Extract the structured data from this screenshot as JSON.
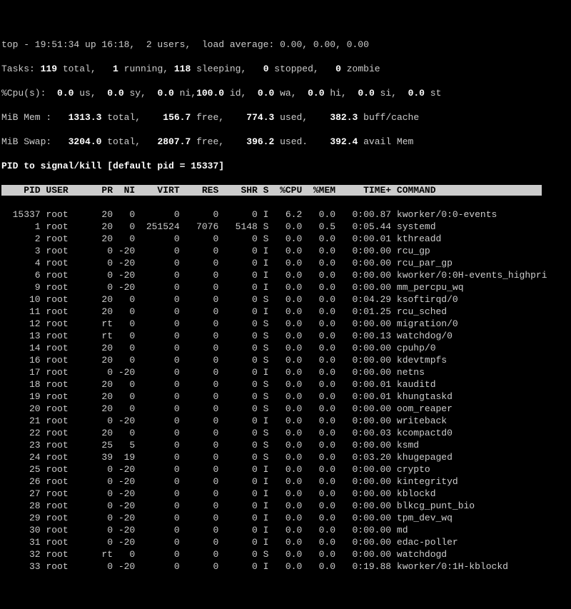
{
  "summary": {
    "line1_a": "top - 19:51:34 up 16:18,  2 users,  load average: 0.00, 0.00, 0.00",
    "tasks": {
      "label": "Tasks:",
      "total": "119",
      "running": "1",
      "sleeping": "118",
      "stopped": "0",
      "zombie": "0"
    },
    "cpu": {
      "label": "%Cpu(s):",
      "us": "0.0",
      "sy": "0.0",
      "ni": "0.0",
      "id": "100.0",
      "wa": "0.0",
      "hi": "0.0",
      "si": "0.0",
      "st": "0.0"
    },
    "mem": {
      "label": "MiB Mem :",
      "total": "1313.3",
      "free": "156.7",
      "used": "774.3",
      "buff": "382.3"
    },
    "swap": {
      "label": "MiB Swap:",
      "total": "3204.0",
      "free": "2807.7",
      "used": "396.2",
      "avail": "392.4"
    }
  },
  "prompt": "PID to signal/kill [default pid = 15337] ",
  "columns": "    PID USER      PR  NI    VIRT    RES    SHR S  %CPU  %MEM     TIME+ COMMAND                   ",
  "rows": [
    {
      "l": "  15337 root      20   0       0      0      0 I   6.2   0.0   0:00.87 kworker/0:0-events        "
    },
    {
      "l": "      1 root      20   0  251524   7076   5148 S   0.0   0.5   0:05.44 systemd                   "
    },
    {
      "l": "      2 root      20   0       0      0      0 S   0.0   0.0   0:00.01 kthreadd                  "
    },
    {
      "l": "      3 root       0 -20       0      0      0 I   0.0   0.0   0:00.00 rcu_gp                    "
    },
    {
      "l": "      4 root       0 -20       0      0      0 I   0.0   0.0   0:00.00 rcu_par_gp                "
    },
    {
      "l": "      6 root       0 -20       0      0      0 I   0.0   0.0   0:00.00 kworker/0:0H-events_highpri"
    },
    {
      "l": "      9 root       0 -20       0      0      0 I   0.0   0.0   0:00.00 mm_percpu_wq              "
    },
    {
      "l": "     10 root      20   0       0      0      0 S   0.0   0.0   0:04.29 ksoftirqd/0               "
    },
    {
      "l": "     11 root      20   0       0      0      0 I   0.0   0.0   0:01.25 rcu_sched                 "
    },
    {
      "l": "     12 root      rt   0       0      0      0 S   0.0   0.0   0:00.00 migration/0               "
    },
    {
      "l": "     13 root      rt   0       0      0      0 S   0.0   0.0   0:00.13 watchdog/0                "
    },
    {
      "l": "     14 root      20   0       0      0      0 S   0.0   0.0   0:00.00 cpuhp/0                   "
    },
    {
      "l": "     16 root      20   0       0      0      0 S   0.0   0.0   0:00.00 kdevtmpfs                 "
    },
    {
      "l": "     17 root       0 -20       0      0      0 I   0.0   0.0   0:00.00 netns                     "
    },
    {
      "l": "     18 root      20   0       0      0      0 S   0.0   0.0   0:00.01 kauditd                   "
    },
    {
      "l": "     19 root      20   0       0      0      0 S   0.0   0.0   0:00.01 khungtaskd                "
    },
    {
      "l": "     20 root      20   0       0      0      0 S   0.0   0.0   0:00.00 oom_reaper                "
    },
    {
      "l": "     21 root       0 -20       0      0      0 I   0.0   0.0   0:00.00 writeback                 "
    },
    {
      "l": "     22 root      20   0       0      0      0 S   0.0   0.0   0:00.03 kcompactd0                "
    },
    {
      "l": "     23 root      25   5       0      0      0 S   0.0   0.0   0:00.00 ksmd                      "
    },
    {
      "l": "     24 root      39  19       0      0      0 S   0.0   0.0   0:03.20 khugepaged                "
    },
    {
      "l": "     25 root       0 -20       0      0      0 I   0.0   0.0   0:00.00 crypto                    "
    },
    {
      "l": "     26 root       0 -20       0      0      0 I   0.0   0.0   0:00.00 kintegrityd               "
    },
    {
      "l": "     27 root       0 -20       0      0      0 I   0.0   0.0   0:00.00 kblockd                   "
    },
    {
      "l": "     28 root       0 -20       0      0      0 I   0.0   0.0   0:00.00 blkcg_punt_bio            "
    },
    {
      "l": "     29 root       0 -20       0      0      0 I   0.0   0.0   0:00.00 tpm_dev_wq                "
    },
    {
      "l": "     30 root       0 -20       0      0      0 I   0.0   0.0   0:00.00 md                        "
    },
    {
      "l": "     31 root       0 -20       0      0      0 I   0.0   0.0   0:00.00 edac-poller               "
    },
    {
      "l": "     32 root      rt   0       0      0      0 S   0.0   0.0   0:00.00 watchdogd                 "
    },
    {
      "l": "     33 root       0 -20       0      0      0 I   0.0   0.0   0:19.88 kworker/0:1H-kblockd      "
    }
  ]
}
